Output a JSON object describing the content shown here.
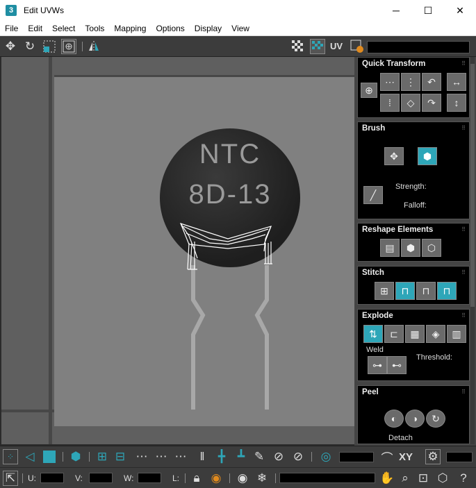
{
  "window": {
    "app_icon": "3",
    "title": "Edit UVWs",
    "minimize": "─",
    "maximize": "☐",
    "close": "✕"
  },
  "menu": [
    "File",
    "Edit",
    "Select",
    "Tools",
    "Mapping",
    "Options",
    "Display",
    "View"
  ],
  "top_toolbar": {
    "icons": [
      "move-icon",
      "rotate-icon",
      "scale-icon",
      "freeform-icon",
      "mirror-icon",
      "checker-icon",
      "checker-pattern-icon",
      "uv-label",
      "texture-settings-icon"
    ],
    "uv_label": "UV",
    "texture_dropdown_value": ""
  },
  "viewport": {
    "texture_text_line1": "NTC",
    "texture_text_line2": "8D-13"
  },
  "rollouts": {
    "quick_transform": {
      "title": "Quick Transform"
    },
    "brush": {
      "title": "Brush",
      "strength_label": "Strength:",
      "falloff_label": "Falloff:"
    },
    "reshape": {
      "title": "Reshape Elements"
    },
    "stitch": {
      "title": "Stitch"
    },
    "explode": {
      "title": "Explode",
      "weld_label": "Weld",
      "threshold_label": "Threshold:"
    },
    "peel": {
      "title": "Peel",
      "detach_label": "Detach"
    }
  },
  "bottom_toolbar": {
    "xy_label": "XY",
    "u_label": "U:",
    "v_label": "V:",
    "w_label": "W:",
    "l_label": "L:",
    "u_value": "",
    "v_value": "",
    "w_value": "",
    "l_value": ""
  },
  "colors": {
    "accent_teal": "#2ea6b8",
    "panel_bg": "#444444",
    "rollout_bg": "#000000",
    "viewport_bg": "#5f5f5f",
    "texture_bg": "#808080"
  }
}
